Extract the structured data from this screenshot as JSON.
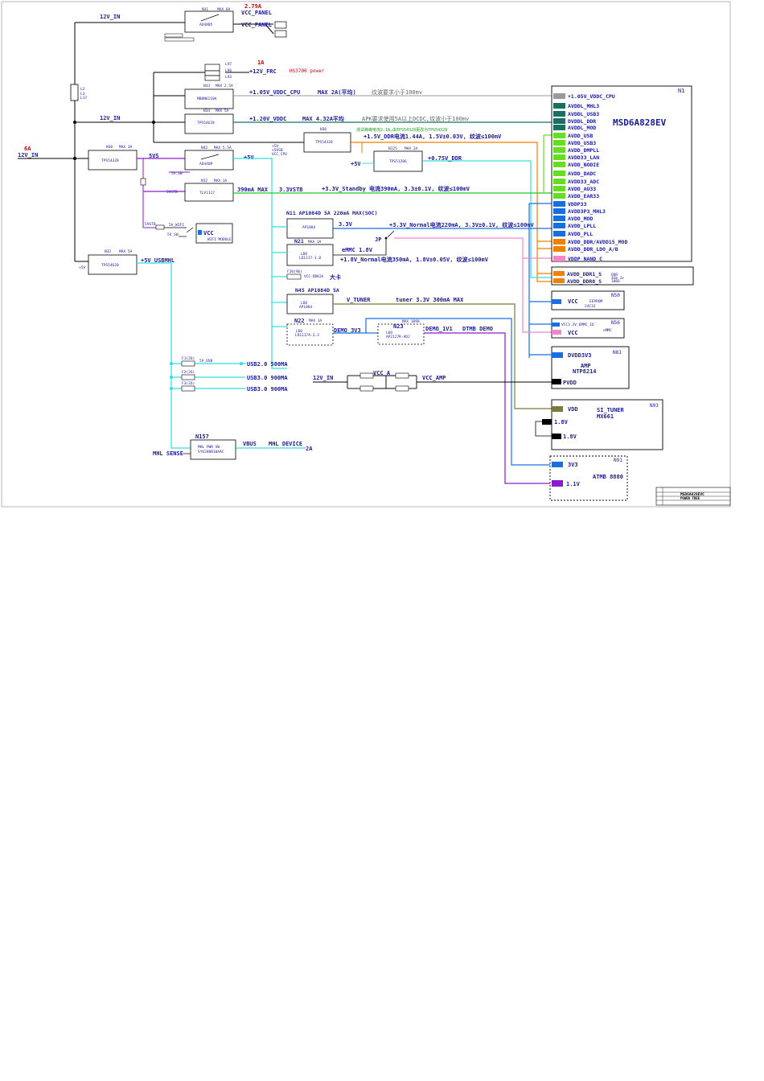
{
  "title": {
    "chip": "MSD6A828EV",
    "chip_ref": "N1",
    "block_title": "MSD6A828EVC",
    "block_sub": "POWER TREE"
  },
  "rails": {
    "12v_in_top": "12V_IN",
    "12v_in_mid": "12V_IN",
    "12v_in_main": "12V_IN",
    "12v_in_amp": "12V_IN",
    "main_current": "6A",
    "vcc_panel": "VCC_PANEL",
    "vcc_panel_current": "2.79A",
    "vcc_panel2": "VCC_PANEL",
    "12v_frc": "+12V_FRC",
    "frc_current": "1A",
    "frc_note": "HS3700 power",
    "vddc_cpu": "+1.05V_VDDC_CPU",
    "vddc_cpu_max": "MAX 2A(平均)",
    "vddc_cpu_ripple": "纹波要求小于100mv",
    "vddc": "+1.20V_VDDC",
    "vddc_max": "MAX  4.32A平均",
    "vddc_note": "APK要求使用5A以上DCDC,纹波小于100mv",
    "ddr_test": "测试峰峰电流2.1A,由TPS54328更改为TPS54328",
    "ddr_rail": "+1.5V_DDR电流1.44A, 1.5V±0.03V, 纹波≤100mV",
    "5vs": "5VS",
    "5v": "+5V",
    "5v_b": "+5V",
    "075_ddr": "+0.75V_DDR",
    "standby": "+3.3V_Standby 电流390mA, 3.3±0.1V, 纹波≤100mV",
    "n12_max": "390mA MAX",
    "33vstb": "3.3VSTB",
    "n11_title": "N11 AP1084D   5A    220mA MAX(SOC)",
    "33v": "3.3V",
    "33v_normal": "+3.3V_Normal电流220mA, 3.3V±0.1V, 纹波≤100mV",
    "jp": "JP",
    "emmc18": "eMMC 1.8V",
    "18v_normal": "+1.8V_Normal电流350mA, 1.8V±0.05V, 纹波≤100mV",
    "daka": "大卡",
    "n45_title": "N45  AP1084D    5A",
    "v_tuner": "V_TUNER",
    "tuner_note": "tuner 3.3V     300mA MAX",
    "n22": "N22",
    "demo_3v3": "DEMO_3V3",
    "n23": "N23",
    "demo_1v1": "DEMO_1V1",
    "dtmb_demo": "DTMB DEMO",
    "5v_usbmhl": "+5V_USBMHL",
    "usb20": "USB2.0  500MA",
    "usb30a": "USB3.0  900MA",
    "usb30b": "USB3.0  900MA",
    "vcc_a": "VCC_A",
    "vcc_amp": "VCC_AMP",
    "vbus": "VBUS",
    "mhl_device": "MHL DEVICE",
    "mhl_2a": "2A",
    "mhl_sense": "MHL SENSE"
  },
  "chips": {
    "n1_pins": [
      "+1.05V_VDDC_CPU",
      "AVDDL_MHL3",
      "AVDDL_USB3",
      "DVDDL_DDR",
      "AVDDL_MOD",
      "AVDD_USB",
      "AVDD_USB3",
      "AVDD_DMPLL",
      "AVDD33_LAN",
      "AVDD_NODIE",
      "AVDD_DADC",
      "AVDD33_ADC",
      "AVDD_AU33",
      "AVDD_EAR33",
      "VDDP33",
      "AVDD3P3_MHL3",
      "AVDD_MOD",
      "AVDD_LPLL",
      "AVDD_PLL",
      "AVDD_DDR/AVDD15_MOD",
      "AVDD_DDR_LDO_A/B",
      "VDDP_NAND_C"
    ],
    "ddr_pins": [
      "AVDD_DDR1_S",
      "AVDD_DDR0_S"
    ],
    "n50": {
      "ref": "N50",
      "pin": "VCC",
      "part": "EEPROM",
      "part2": "24C32"
    },
    "n56": {
      "ref": "N56",
      "pin1": "VCC3.3V_EMMC_IO",
      "pin2": "VCC",
      "part": "eMMC"
    },
    "n81": {
      "ref": "N81",
      "pin1": "DVDD3V3",
      "part": "AMP",
      "part2": "NTP8214",
      "pin2": "PVDD"
    },
    "n93": {
      "ref": "N93",
      "pin1": "VDD",
      "part": "SI_TUNER",
      "part2": "MX661",
      "pin2": "1.8V",
      "pin3": "1.8V"
    },
    "n91": {
      "ref": "N91",
      "pin1": "3V3",
      "part": "ATMB 8880",
      "pin2": "1.1V"
    },
    "n157": {
      "ref": "N157",
      "part": "MHL PWR SW",
      "part2": "SY6288B10AAC"
    },
    "wifi": {
      "pin": "VCC",
      "part": "WIFI MODULE"
    },
    "ic_aod": "AO4805",
    "ic_mb": "MB8N6110A",
    "ic_tps1": "TPS54628",
    "ic_tps2": "TPS54328",
    "ic_tps3": "TPS51206",
    "ic_tps4": "TPS54328",
    "ic_tps5": "TPS54620",
    "ic_ao": "AO4409",
    "ic_n12": "TLV1117"
  },
  "colors": {
    "navy": "#1a1a9a",
    "black": "#000000",
    "teal": "#1a6f60",
    "gray": "#9a9a9a",
    "green": "#20c820",
    "lime": "#66dd22",
    "blue": "#1a6fe0",
    "orange": "#f08000",
    "pink": "#f088c8",
    "cyan": "#30e0e0",
    "purple": "#8a1acc",
    "olive": "#7a7a3a",
    "red": "#d40000"
  }
}
